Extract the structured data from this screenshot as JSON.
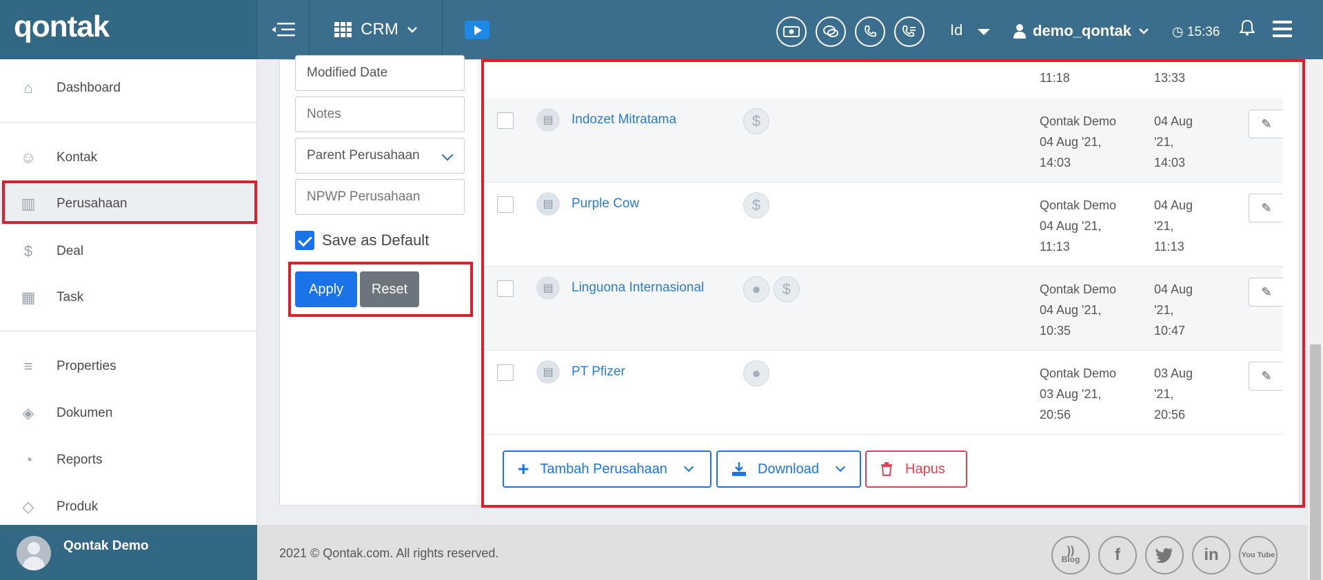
{
  "header": {
    "logo": "qontak",
    "module": "CRM",
    "language": "Id",
    "username": "demo_qontak",
    "time": "15:36"
  },
  "sidebar": {
    "items": [
      {
        "label": "Dashboard",
        "icon": "home-icon"
      },
      {
        "label": "Kontak",
        "icon": "users-icon"
      },
      {
        "label": "Perusahaan",
        "icon": "building-icon"
      },
      {
        "label": "Deal",
        "icon": "dollar-icon"
      },
      {
        "label": "Task",
        "icon": "calendar-icon"
      },
      {
        "label": "Properties",
        "icon": "list-icon"
      },
      {
        "label": "Dokumen",
        "icon": "layers-icon"
      },
      {
        "label": "Reports",
        "icon": "pie-chart-icon"
      },
      {
        "label": "Produk",
        "icon": "tag-icon"
      }
    ],
    "user_name": "Qontak Demo"
  },
  "filter": {
    "modified_date": "Modified Date",
    "notes_placeholder": "Notes",
    "parent_company": "Parent Perusahaan",
    "npwp_placeholder": "NPWP Perusahaan",
    "save_default_label": "Save as Default",
    "apply_label": "Apply",
    "reset_label": "Reset"
  },
  "table": {
    "partial_row": {
      "owner_time": "11:18",
      "modified_time": "13:33"
    },
    "rows": [
      {
        "name": "Indozet Mitratama",
        "badges": [
          "dollar"
        ],
        "owner": [
          "Qontak Demo",
          "04 Aug '21,",
          "14:03"
        ],
        "modified": [
          "04 Aug",
          "'21,",
          "14:03"
        ]
      },
      {
        "name": "Purple Cow",
        "badges": [
          "dollar"
        ],
        "owner": [
          "Qontak Demo",
          "04 Aug '21,",
          "11:13"
        ],
        "modified": [
          "04 Aug",
          "'21,",
          "11:13"
        ]
      },
      {
        "name": "Linguona Internasional",
        "badges": [
          "person",
          "dollar"
        ],
        "owner": [
          "Qontak Demo",
          "04 Aug '21,",
          "10:35"
        ],
        "modified": [
          "04 Aug",
          "'21,",
          "10:47"
        ]
      },
      {
        "name": "PT Pfizer",
        "badges": [
          "person"
        ],
        "owner": [
          "Qontak Demo",
          "03 Aug '21,",
          "20:56"
        ],
        "modified": [
          "03 Aug",
          "'21,",
          "20:56"
        ]
      }
    ]
  },
  "actions": {
    "add_label": "Tambah Perusahaan",
    "download_label": "Download",
    "delete_label": "Hapus"
  },
  "footer": {
    "copyright": "2021 © Qontak.com. All rights reserved.",
    "blog": "Blog",
    "youtube": "You Tube"
  },
  "colors": {
    "header_bg": "#3a6e8c",
    "primary": "#1a73e8",
    "danger": "#e04050",
    "highlight": "#e01e2a"
  }
}
